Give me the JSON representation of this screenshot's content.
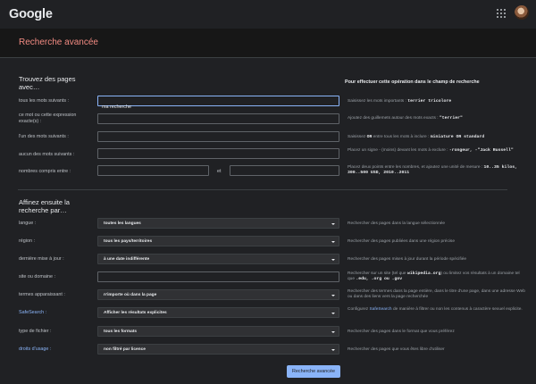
{
  "header": {
    "logo": "Google",
    "apps_icon": "apps-grid-icon",
    "avatar_icon": "avatar"
  },
  "page_title": "Recherche avancée",
  "section1": {
    "title": "Trouvez des pages avec…",
    "help_heading": "Pour effectuer cette opération dans le champ de recherche",
    "rows": [
      {
        "label": "tous les mots suivants :",
        "value": "ma recherche",
        "help_pre": "Saisissez les mots importants : ",
        "help_mono": "terrier tricolore"
      },
      {
        "label": "ce mot ou cette expression exacte(s) :",
        "value": "",
        "help_pre": "Ajoutez des guillemets autour des mots exacts : ",
        "help_mono": "\"terrier\""
      },
      {
        "label": "l'un des mots suivants :",
        "value": "",
        "help_pre": "Saisissez ",
        "help_mono": "OR",
        "help_post": " entre tous les mots à inclure : ",
        "help_mono2": "miniature OR standard"
      },
      {
        "label": "aucun des mots suivants :",
        "value": "",
        "help_pre": "Placez un signe - (moins) devant les mots à exclure : ",
        "help_mono": "-rongeur, -\"Jack Russell\""
      },
      {
        "label": "nombres compris entre :",
        "value_from": "",
        "value_to": "",
        "and_label": "et",
        "help_pre": "Placez deux points entre les nombres, et ajoutez une unité de mesure : ",
        "help_mono": "10..35 kilos, 300..500 USD, 2010..2011"
      }
    ]
  },
  "section2": {
    "title": "Affinez ensuite la recherche par…",
    "rows": [
      {
        "label": "langue :",
        "value": "toutes les langues",
        "help": "Rechercher des pages dans la langue sélectionnée"
      },
      {
        "label": "région :",
        "value": "tous les pays/territoires",
        "help": "Rechercher des pages publiées dans une région précise"
      },
      {
        "label": "dernière mise à jour :",
        "value": "à une date indifférente",
        "help": "Rechercher des pages mises à jour durant la période spécifiée"
      },
      {
        "label": "site ou domaine :",
        "value": "",
        "help_pre": "Rechercher sur un site (tel que ",
        "help_mono": "wikipedia.org",
        "help_mid": ") ou limitez vos résultats à un domaine tel que ",
        "help_mono2": ".edu, .org ou .gov"
      },
      {
        "label": "termes apparaissant :",
        "value": "n'importe où dans la page",
        "help": "Rechercher des termes dans la page entière, dans le titre d'une page, dans une adresse Web ou dans des liens vers la page recherchée"
      },
      {
        "label": "SafeSearch :",
        "value": "Afficher les résultats explicites",
        "help_pre": "Configurez ",
        "help_link": "SafeSearch",
        "help_post": " de manière à filtrer ou non les contenus à caractère sexuel explicite."
      },
      {
        "label": "type de fichier :",
        "value": "tous les formats",
        "help": "Rechercher des pages dans le format que vous préférez"
      },
      {
        "label": "droits d'usage :",
        "value": "non filtré par licence",
        "help": "Rechercher des pages que vous êtes libre d'utiliser"
      }
    ]
  },
  "submit_label": "Recherche avancée"
}
